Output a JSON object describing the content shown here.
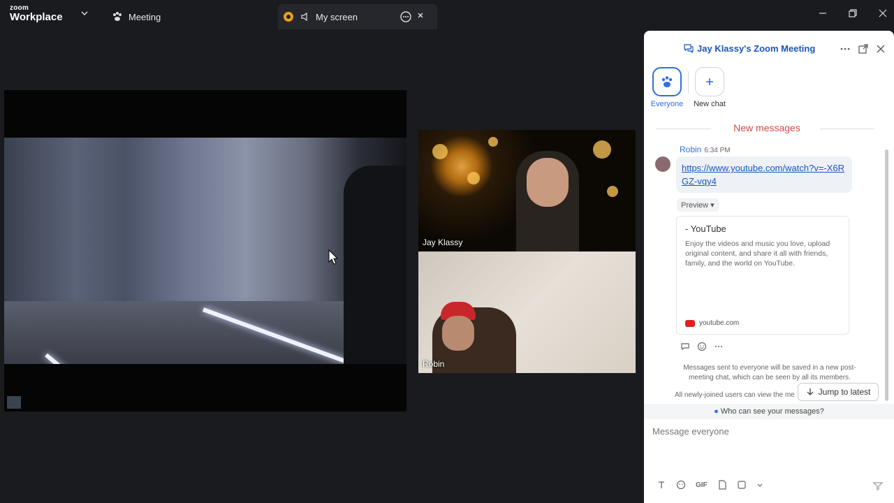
{
  "titlebar": {
    "logo_small": "zoom",
    "logo_big": "Workplace",
    "tabs": [
      {
        "label": "Meeting",
        "icon": "paw-icon"
      },
      {
        "label": "My screen",
        "icon": "speaker-icon"
      }
    ]
  },
  "videos": {
    "participant1_name": "Jay Klassy",
    "participant2_name": "Robin"
  },
  "chat_panel": {
    "title": "Jay Klassy's Zoom Meeting",
    "chips": [
      {
        "label": "Everyone"
      },
      {
        "label": "New chat"
      }
    ],
    "new_messages_label": "New messages",
    "message": {
      "sender": "Robin",
      "time": "6:34 PM",
      "link": "https://www.youtube.com/watch?v=-X6RGZ-vqy4"
    },
    "preview_label": "Preview ▾",
    "card": {
      "title": "- YouTube",
      "description": "Enjoy the videos and music you love, upload original content, and share it all with friends, family, and the world on YouTube.",
      "domain": "youtube.com"
    },
    "notice": "Messages sent to everyone will be saved in a new post-meeting chat, which can be seen by all its members.",
    "notice2": "All newly-joined users can view the me",
    "jump_label": "Jump to latest",
    "who_label": "Who can see your messages?",
    "input_placeholder": "Message everyone",
    "toolbar_gif": "GIF",
    "colors": {
      "accent": "#2d6fe0",
      "new_messages": "#d14a4a"
    }
  }
}
